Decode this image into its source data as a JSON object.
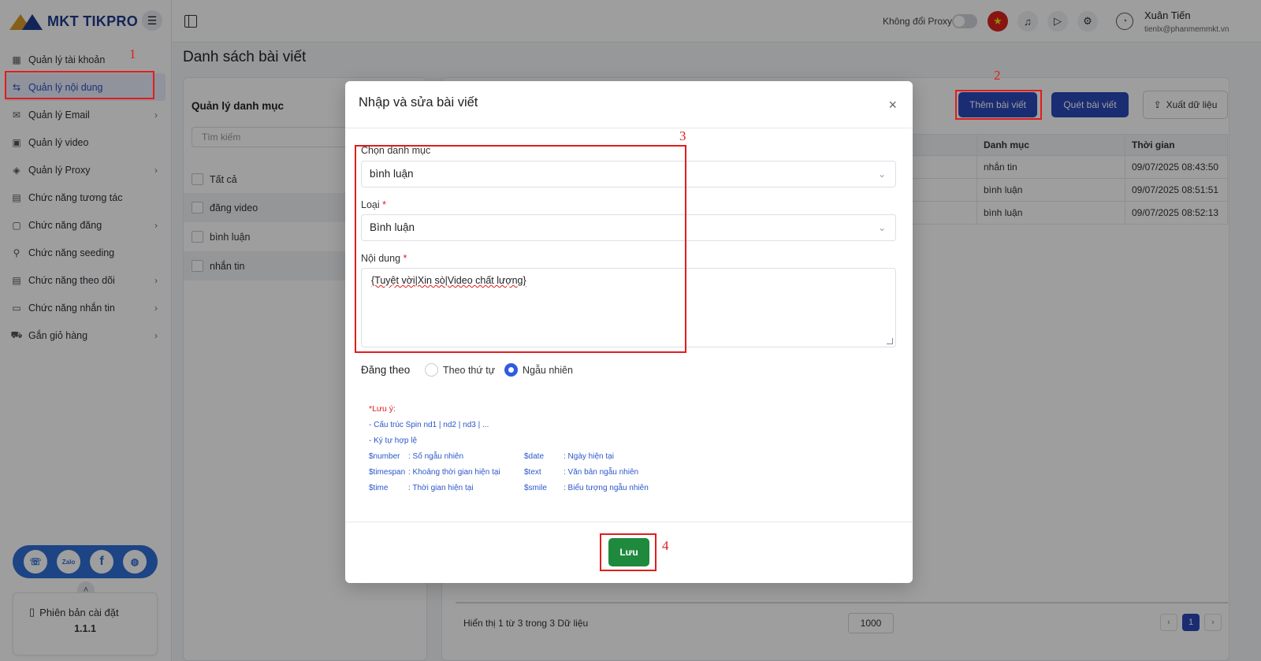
{
  "app": {
    "logo_text": "MKT TIKPRO"
  },
  "sidebar": {
    "items": [
      {
        "label": "Quản lý tài khoản",
        "icon": "grid-icon",
        "chev": ""
      },
      {
        "label": "Quản lý nội dung",
        "icon": "content-icon",
        "chev": ""
      },
      {
        "label": "Quản lý Email",
        "icon": "mail-icon",
        "chev": "›"
      },
      {
        "label": "Quản lý video",
        "icon": "video-icon",
        "chev": ""
      },
      {
        "label": "Quản lý Proxy",
        "icon": "layers-icon",
        "chev": "›"
      },
      {
        "label": "Chức năng tương tác",
        "icon": "interact-icon",
        "chev": ""
      },
      {
        "label": "Chức năng đăng",
        "icon": "post-icon",
        "chev": "›"
      },
      {
        "label": "Chức năng seeding",
        "icon": "seeding-icon",
        "chev": ""
      },
      {
        "label": "Chức năng theo dõi",
        "icon": "follow-icon",
        "chev": "›"
      },
      {
        "label": "Chức năng nhắn tin",
        "icon": "chat-icon",
        "chev": "›"
      },
      {
        "label": "Gắn giỏ hàng",
        "icon": "cart-icon",
        "chev": "›"
      }
    ],
    "version_label": "Phiên bản cài đặt",
    "version_number": "1.1.1",
    "social": {
      "zalo": "Zalo",
      "facebook": "f"
    }
  },
  "topbar": {
    "proxy_label": "Không đổi Proxy",
    "user_name": "Xuân Tiến",
    "user_email": "tienlx@phanmemmkt.vn"
  },
  "main": {
    "page_title": "Danh sách bài viết",
    "category_panel": {
      "title": "Quản lý danh mục",
      "search_placeholder": "Tìm kiếm",
      "items": [
        "Tất cả",
        "đăng video",
        "bình luận",
        "nhắn tin"
      ]
    },
    "buttons": {
      "add": "Thêm bài viết",
      "scan": "Quét bài viết",
      "export": "Xuất dữ liệu"
    },
    "table": {
      "headers": {
        "category": "Danh mục",
        "time": "Thời gian"
      },
      "rows": [
        {
          "category": "nhắn tin",
          "time": "09/07/2025 08:43:50"
        },
        {
          "category": "bình luận",
          "time": "09/07/2025 08:51:51"
        },
        {
          "category": "bình luận",
          "time": "09/07/2025 08:52:13"
        }
      ]
    },
    "footer": {
      "summary": "Hiển thị 1 từ 3 trong 3 Dữ liệu",
      "page_size": "1000",
      "prev": "‹",
      "current_page": "1",
      "next": "›"
    }
  },
  "modal": {
    "title": "Nhập và sửa bài viết",
    "close": "×",
    "category_label": "Chọn danh mục",
    "category_value": "bình luận",
    "type_label": "Loại",
    "type_value": "Bình luận",
    "content_label": "Nội dung",
    "content_value": "{Tuyệt vời|Xin sò|Video chất lượng}",
    "required_mark": "*",
    "post_label": "Đăng theo",
    "radio_options": [
      {
        "label": "Theo thứ tự",
        "selected": false
      },
      {
        "label": "Ngẫu nhiên",
        "selected": true
      }
    ],
    "notes": {
      "heading": "*Lưu ý:",
      "spin": "- Cấu trúc Spin nd1 | nd2 | nd3 | ...",
      "valid_chars": "- Ký tự hợp lệ",
      "vars": [
        {
          "key": "$number",
          "desc": ": Số ngẫu nhiên"
        },
        {
          "key": "$timespan",
          "desc": ": Khoảng thời gian hiện tại"
        },
        {
          "key": "$time",
          "desc": ": Thời gian hiện tại"
        },
        {
          "key": "$date",
          "desc": ": Ngày hiện tại"
        },
        {
          "key": "$text",
          "desc": ": Văn bản ngẫu nhiên"
        },
        {
          "key": "$smile",
          "desc": ": Biểu tượng ngẫu nhiên"
        }
      ]
    },
    "save_label": "Lưu"
  },
  "annotations": {
    "n1": "1",
    "n2": "2",
    "n3": "3",
    "n4": "4"
  },
  "colors": {
    "primary": "#2a47b8",
    "save": "#1f8a3e",
    "annotation": "#e11d1d"
  }
}
